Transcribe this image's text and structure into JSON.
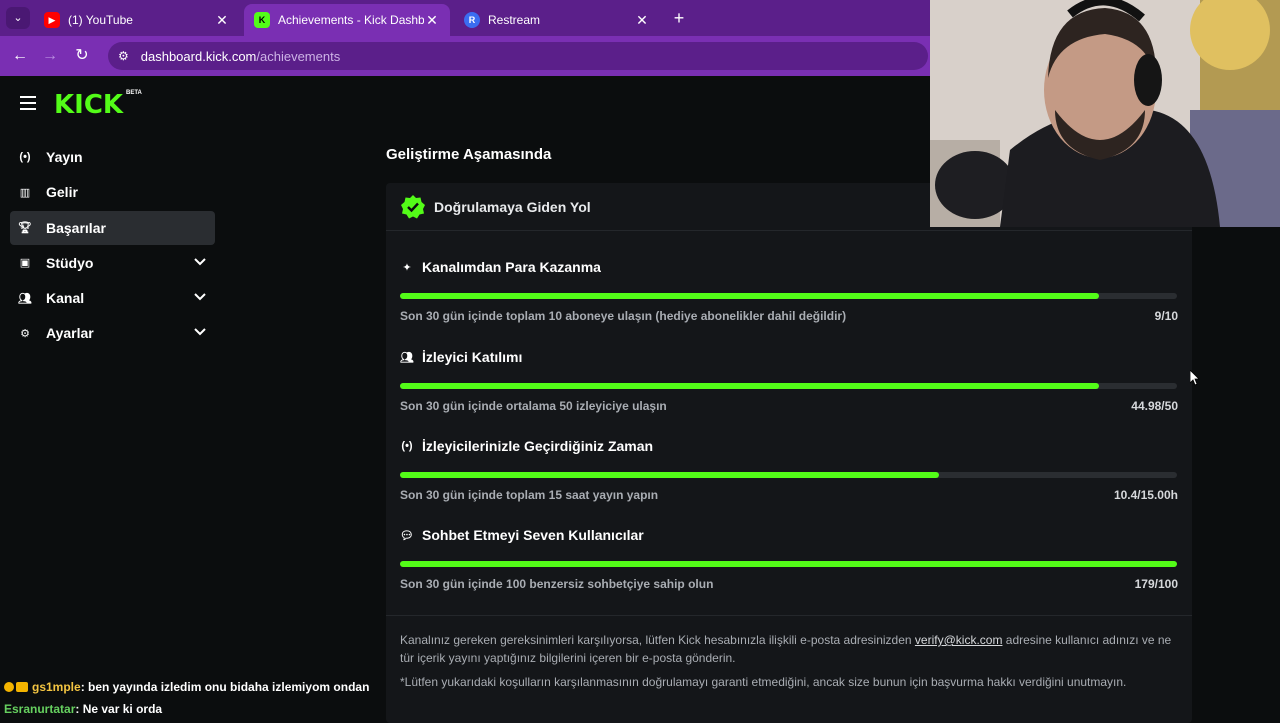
{
  "browser": {
    "tabs": [
      {
        "label": "(1) YouTube",
        "favicon": "youtube-icon",
        "active": false
      },
      {
        "label": "Achievements - Kick Dashboard",
        "favicon": "kick-icon",
        "active": true
      },
      {
        "label": "Restream",
        "favicon": "restream-icon",
        "active": false
      }
    ],
    "url_host": "dashboard.kick.com",
    "url_path": "/achievements"
  },
  "logo": {
    "text": "KICK",
    "badge": "BETA"
  },
  "sidebar": {
    "items": [
      {
        "label": "Yayın",
        "icon": "broadcast-icon"
      },
      {
        "label": "Gelir",
        "icon": "chart-icon"
      },
      {
        "label": "Başarılar",
        "icon": "trophy-icon",
        "active": true
      },
      {
        "label": "Stüdyo",
        "icon": "studio-icon",
        "expandable": true
      },
      {
        "label": "Kanal",
        "icon": "channel-icon",
        "expandable": true
      },
      {
        "label": "Ayarlar",
        "icon": "gear-icon",
        "expandable": true
      }
    ]
  },
  "main": {
    "section_title": "Geliştirme Aşamasında",
    "card_title": "Doğrulamaya Giden Yol",
    "requirements": [
      {
        "title": "Kanalımdan Para Kazanma",
        "icon": "sparkle-icon",
        "description": "Son 30 gün içinde toplam 10 aboneye ulaşın (hediye abonelikler dahil değildir)",
        "value": "9/10",
        "progress": 0.9
      },
      {
        "title": "İzleyici Katılımı",
        "icon": "viewers-icon",
        "description": "Son 30 gün içinde ortalama 50 izleyiciye ulaşın",
        "value": "44.98/50",
        "progress": 0.8996
      },
      {
        "title": "İzleyicilerinizle Geçirdiğiniz Zaman",
        "icon": "live-icon",
        "description": "Son 30 gün içinde toplam 15 saat yayın yapın",
        "value": "10.4/15.00h",
        "progress": 0.6933
      },
      {
        "title": "Sohbet Etmeyi Seven Kullanıcılar",
        "icon": "chat-bubble-icon",
        "description": "Son 30 gün içinde 100 benzersiz sohbetçiye sahip olun",
        "value": "179/100",
        "progress": 1.0
      }
    ],
    "note1_before": "Kanalınız gereken gereksinimleri karşılıyorsa, lütfen Kick hesabınızla ilişkili e-posta adresinizden ",
    "note1_email": "verify@kick.com",
    "note1_after": " adresine kullanıcı adınızı ve ne tür içerik yayını yaptığınız bilgilerini içeren bir e-posta gönderin.",
    "note2": "*Lütfen yukarıdaki koşulların karşılanmasının doğrulamayı garanti etmediğini, ancak size bunun için başvurma hakkı verdiğini unutmayın."
  },
  "chat": [
    {
      "user": "gs1mple",
      "message": ": ben yayında izledim onu bidaha izlemiyom ondan"
    },
    {
      "user": "Esranurtatar",
      "message": ": Ne var ki orda"
    }
  ],
  "colors": {
    "accent": "#53fc18",
    "browser": "#7a2fb3",
    "background": "#0b0d0e",
    "card": "#141619"
  }
}
